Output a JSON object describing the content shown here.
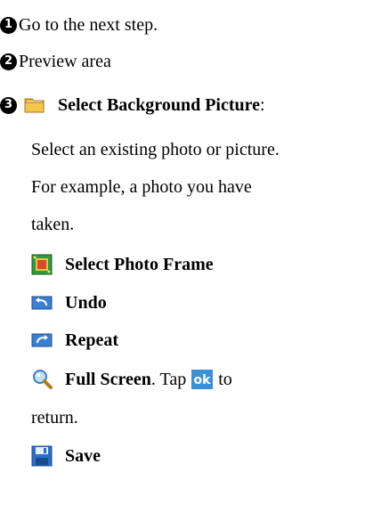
{
  "items": {
    "step1": {
      "number": "❶",
      "text": "Go to the next step."
    },
    "step2": {
      "number": "❷",
      "text": "Preview area"
    },
    "step3": {
      "number": "❸",
      "title": "Select Background Picture",
      "title_suffix": ":",
      "desc_line1": "Select an existing photo or picture.",
      "desc_line2": "For example, a photo you have",
      "desc_line3": "taken."
    },
    "photo_frame": {
      "label": "Select Photo Frame",
      "icon": "photo-frame-icon"
    },
    "undo": {
      "label": "Undo",
      "icon": "undo-icon"
    },
    "repeat": {
      "label": "Repeat",
      "icon": "repeat-icon"
    },
    "full_screen": {
      "label": "Full Screen",
      "text_after": ". Tap",
      "ok_label": "ok",
      "text_end": "to",
      "text_line2": "return.",
      "icon": "magnifier-icon"
    },
    "save": {
      "label": "Save",
      "icon": "floppy-disk-icon"
    }
  },
  "colors": {
    "ok_background": "#3b8fd9",
    "folder_yellow": "#f4c64a",
    "icon_blue": "#1e5fb4"
  }
}
